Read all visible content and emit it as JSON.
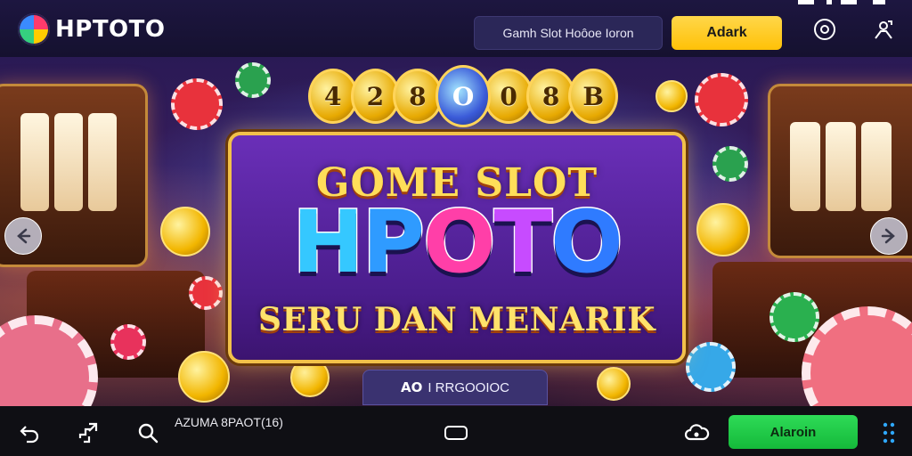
{
  "header": {
    "logo_text": "HPTOTO",
    "search_label": "Gamh Slot Hoôoe Ioron",
    "daftar_label": "Adark",
    "icons": [
      "location-pin-icon",
      "user-share-icon"
    ]
  },
  "hero": {
    "medals": [
      "4",
      "2",
      "8",
      "O",
      "0",
      "8",
      "B"
    ],
    "title_small": "GOME SLOT",
    "title_big": [
      "H",
      "P",
      "O",
      "T",
      "O"
    ],
    "subtitle": "SERU DAN MENARIK",
    "caption": "I RRGOOIOC",
    "caption_logo": "AO",
    "colors": {
      "gold": "#f2c14a",
      "panel_purple": "#6a2fb8",
      "letter_cyan": "#35c8ff",
      "letter_pink": "#ff3fa8",
      "letter_blue": "#2f7bff"
    }
  },
  "navigation": {
    "prev_icon": "chevron-left-icon",
    "next_icon": "chevron-right-icon"
  },
  "bottombar": {
    "text": "AZUMA 8PAOT(16)",
    "masuk_label": "Alaroin",
    "icons": [
      "back-icon",
      "share-icon",
      "search-icon",
      "home-pill-icon",
      "settings-cloud-icon",
      "grid-dots-icon"
    ]
  }
}
